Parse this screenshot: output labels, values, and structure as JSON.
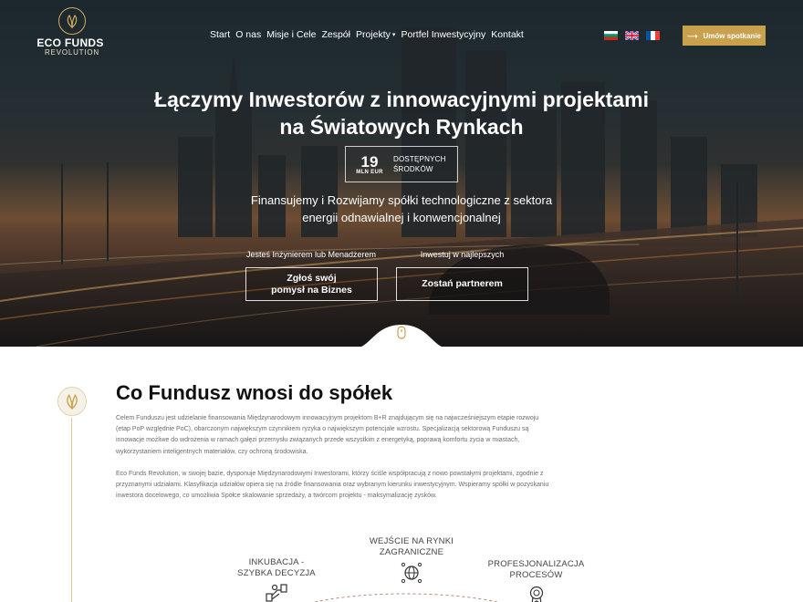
{
  "brand": {
    "name": "ECO FUNDS",
    "tagline": "REVOLUTION"
  },
  "nav": {
    "items": [
      {
        "label": "Start",
        "name": "nav-start"
      },
      {
        "label": "O nas",
        "name": "nav-o-nas"
      },
      {
        "label": "Misje i Cele",
        "name": "nav-misje-i-cele"
      },
      {
        "label": "Zespół",
        "name": "nav-zespol"
      },
      {
        "label": "Projekty",
        "name": "nav-projekty",
        "dropdown": true
      },
      {
        "label": "Portfel Inwestycyjny",
        "name": "nav-portfel"
      },
      {
        "label": "Kontakt",
        "name": "nav-kontakt"
      }
    ],
    "dropdown_caret": "▾"
  },
  "languages": [
    {
      "name": "flag-bg",
      "code": "bg"
    },
    {
      "name": "flag-en",
      "code": "en"
    },
    {
      "name": "flag-fr",
      "code": "fr"
    }
  ],
  "header_cta": {
    "label": "Umów spotkanie",
    "arrow": "⟶"
  },
  "hero": {
    "title_line1": "Łączymy Inwestorów z innowacyjnymi projektami",
    "title_line2": "na Światowych Rynkach",
    "funds_value": "19",
    "funds_unit": "MLN EUR",
    "funds_label_line1": "DOSTĘPNYCH",
    "funds_label_line2": "ŚRODKÓW",
    "subtitle_line1": "Finansujemy i Rozwijamy spółki technologiczne z sektora",
    "subtitle_line2": "energii odnawialnej i konwencjonalnej",
    "left_caption": "Jesteś Inżynierem lub Menadżerem",
    "right_caption": "Inwestuj w najlepszych",
    "left_button_line1": "Zgłoś swój",
    "left_button_line2": "pomysł na Biznes",
    "right_button": "Zostań partnerem"
  },
  "colors": {
    "gold": "#c9a14c",
    "text_dark": "#111111",
    "text_muted": "#6b6b6b"
  },
  "section": {
    "title": "Co Fundusz wnosi do spółek",
    "paragraph1": "Celem Funduszu jest udzielanie finansowania Międzynarodowym innowacyjnym projektom B+R znajdującym się na najwcześniejszym etapie rozwoju (etap PoP względnie PoC), obarczonym największym czynnikiem ryzyka o największym potencjale wzrostu. Specjalizacją sektorową Funduszu są innowacje możliwe do wdrożenia w ramach gałęzi przemysłu związanych przede wszystkim z energetyką, poprawą komfortu życia w miastach, wykorzystaniem inteligentnych materiałów, czy ochroną środowiska.",
    "paragraph2": "Eco Funds Revolution, w swojej bazie, dysponuje Międzynarodowymi Inwestorami, którzy ściśle współpracują z nowo powstałymi projektami, zgodnie z przyznanymi udziałami. Klasyfikacja udziałów opiera się na źródle finansowania oraz wybranym kierunku inwestycyjnym. Wspieramy spółki w pozyskaniu inwestora docelowego, co umożliwia Spółce skalowanie sprzedaży, a twórcom projektu - maksymalizację zysków."
  },
  "steps": [
    {
      "line1": "INKUBACJA -",
      "line2": "SZYBKA DECYZJA",
      "icon": "handshake-icon"
    },
    {
      "line1": "WEJŚCIE NA RYNKI",
      "line2": "ZAGRANICZNE",
      "icon": "globe-icon"
    },
    {
      "line1": "PROFESJONALIZACJA",
      "line2": "PROCESÓW",
      "icon": "award-icon"
    }
  ]
}
